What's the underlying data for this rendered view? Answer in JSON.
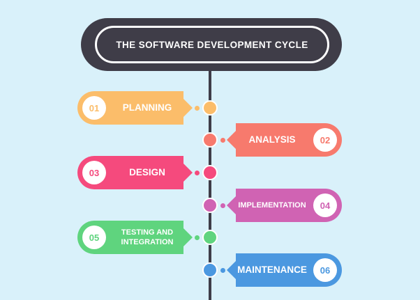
{
  "title": "THE SOFTWARE DEVELOPMENT CYCLE",
  "steps": [
    {
      "num": "01",
      "label": "PLANNING",
      "color": "#fbbd6a",
      "side": "left"
    },
    {
      "num": "02",
      "label": "ANALYSIS",
      "color": "#f77a6d",
      "side": "right"
    },
    {
      "num": "03",
      "label": "DESIGN",
      "color": "#f54a7d",
      "side": "left"
    },
    {
      "num": "04",
      "label": "IMPLEMENTATION",
      "color": "#d063b3",
      "side": "right"
    },
    {
      "num": "05",
      "label": "TESTING AND\nINTEGRATION",
      "color": "#5fd47e",
      "side": "left"
    },
    {
      "num": "06",
      "label": "MAINTENANCE",
      "color": "#4b98e0",
      "side": "right"
    }
  ]
}
